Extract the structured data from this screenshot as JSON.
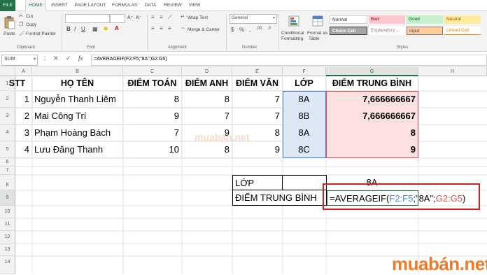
{
  "ribbon_tabs": [
    "FILE",
    "HOME",
    "INSERT",
    "PAGE LAYOUT",
    "FORMULAS",
    "DATA",
    "REVIEW",
    "VIEW"
  ],
  "clipboard": {
    "paste": "Paste",
    "cut": "Cut",
    "copy": "Copy",
    "format_painter": "Format Painter",
    "group": "Clipboard"
  },
  "font": {
    "group": "Font"
  },
  "alignment": {
    "wrap_text": "Wrap Text",
    "merge_center": "Merge & Center",
    "group": "Alignment"
  },
  "number": {
    "format_value": "General",
    "group": "Number"
  },
  "styles": {
    "conditional": "Conditional",
    "formatting": "Formatting",
    "format_as": "Format as",
    "table": "Table",
    "group": "Styles",
    "cells": [
      "Normal",
      "Bad",
      "Good",
      "Neutral",
      "Check Cell",
      "Explanatory ...",
      "Input",
      "Linked Cell"
    ]
  },
  "formula_bar": {
    "name_box": "SUM",
    "fx": "fx",
    "formula": "=AVERAGEIF(F2:F5;\"8A\";G2:G5)"
  },
  "columns": [
    "A",
    "B",
    "C",
    "D",
    "E",
    "F",
    "G",
    "H"
  ],
  "rows": [
    "1",
    "2",
    "3",
    "4",
    "5",
    "6",
    "7",
    "8",
    "9",
    "10",
    "11",
    "12",
    "13",
    "14"
  ],
  "table": {
    "headers": [
      "STT",
      "HỌ TÊN",
      "ĐIỂM TOÁN",
      "ĐIỂM ANH",
      "ĐIỂM VĂN",
      "LỚP",
      "ĐIỂM TRUNG BÌNH"
    ],
    "rows": [
      [
        "1",
        "Nguyễn Thanh Liêm",
        "8",
        "8",
        "7",
        "8A",
        "7,666666667"
      ],
      [
        "2",
        "Mai Công Trí",
        "9",
        "7",
        "7",
        "8B",
        "7,666666667"
      ],
      [
        "3",
        "Phạm Hoàng Bách",
        "7",
        "9",
        "8",
        "8A",
        "8"
      ],
      [
        "4",
        "Lưu Đăng Thanh",
        "10",
        "8",
        "9",
        "8C",
        "9"
      ]
    ]
  },
  "lookup": {
    "class_label": "LỚP",
    "class_value": "8A",
    "avg_label": "ĐIỂM TRUNG BÌNH"
  },
  "formula_parts": {
    "p1": "=AVERAGEIF(",
    "p2": "F2:F5",
    "p3": ";\"8A\";",
    "p4": "G2:G5",
    "p5": ")"
  },
  "watermark": {
    "center": "muabán.net",
    "corner": "muabán.net"
  },
  "colors": {
    "excel_green": "#217346",
    "range_blue": "#4a7fd4",
    "range_red": "#e05050",
    "highlight_border": "#d62020"
  }
}
